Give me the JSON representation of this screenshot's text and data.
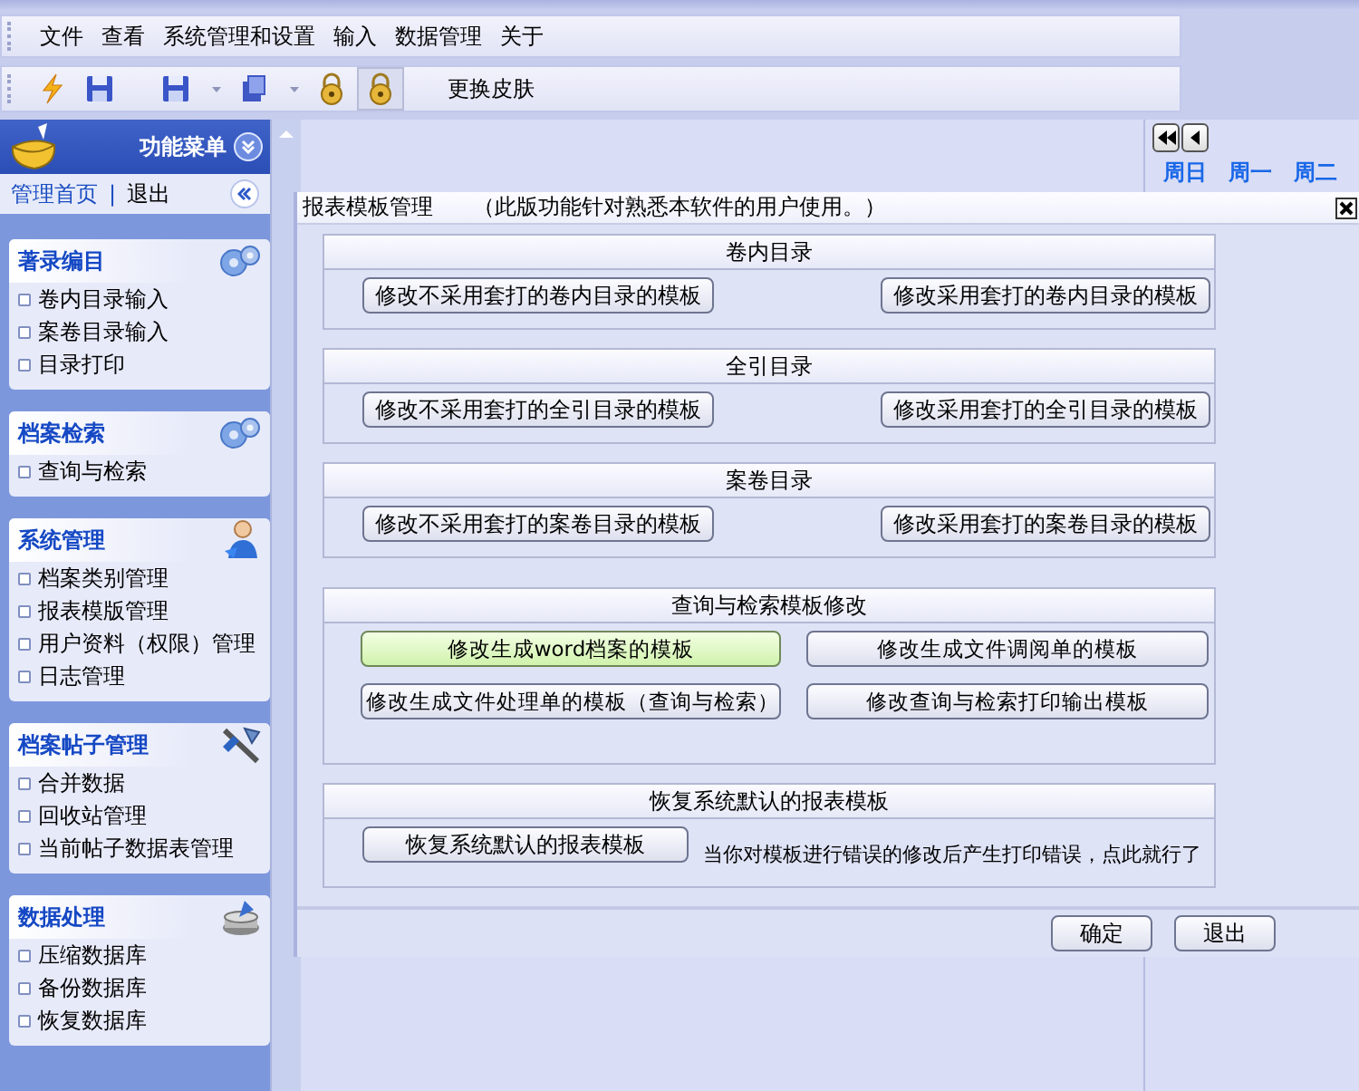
{
  "menu": [
    "文件",
    "查看",
    "系统管理和设置",
    "输入",
    "数据管理",
    "关于"
  ],
  "toolbar": {
    "skin_button": "更换皮肤"
  },
  "sidebar": {
    "title": "功能菜单",
    "home_link": "管理首页",
    "separator": "|",
    "exit_link": "退出",
    "sections": [
      {
        "title": "著录编目",
        "items": [
          "卷内目录输入",
          "案卷目录输入",
          "目录打印"
        ]
      },
      {
        "title": "档案检索",
        "items": [
          "查询与检索"
        ]
      },
      {
        "title": "系统管理",
        "items": [
          "档案类别管理",
          "报表模版管理",
          "用户资料（权限）管理",
          "日志管理"
        ]
      },
      {
        "title": "档案帖子管理",
        "items": [
          "合并数据",
          "回收站管理",
          "当前帖子数据表管理"
        ]
      },
      {
        "title": "数据处理",
        "items": [
          "压缩数据库",
          "备份数据库",
          "恢复数据库"
        ]
      }
    ]
  },
  "calendar": {
    "weekdays": [
      "周日",
      "周一",
      "周二"
    ]
  },
  "dialog": {
    "title": "报表模板管理",
    "note": "（此版功能针对熟悉本软件的用户使用。）",
    "groups": [
      {
        "title": "卷内目录",
        "kind": "pair",
        "buttons": [
          {
            "label": "修改不采用套打的卷内目录的模板",
            "highlighted": false
          },
          {
            "label": "修改采用套打的卷内目录的模板",
            "highlighted": false
          }
        ]
      },
      {
        "title": "全引目录",
        "kind": "pair",
        "buttons": [
          {
            "label": "修改不采用套打的全引目录的模板",
            "highlighted": false
          },
          {
            "label": "修改采用套打的全引目录的模板",
            "highlighted": false
          }
        ]
      },
      {
        "title": "案卷目录",
        "kind": "pair",
        "buttons": [
          {
            "label": "修改不采用套打的案卷目录的模板",
            "highlighted": false
          },
          {
            "label": "修改采用套打的案卷目录的模板",
            "highlighted": false
          }
        ]
      },
      {
        "title": "查询与检索模板修改",
        "kind": "grid",
        "buttons": [
          {
            "label": "修改生成word档案的模板",
            "highlighted": true
          },
          {
            "label": "修改生成文件调阅单的模板",
            "highlighted": false
          },
          {
            "label": "修改生成文件处理单的模板（查询与检索）",
            "highlighted": false
          },
          {
            "label": "修改查询与检索打印输出模板",
            "highlighted": false
          }
        ]
      },
      {
        "title": "恢复系统默认的报表模板",
        "kind": "action",
        "buttons": [
          {
            "label": "恢复系统默认的报表模板",
            "highlighted": false
          }
        ],
        "hint": "当你对模板进行错误的修改后产生打印错误，点此就行了"
      }
    ],
    "footer_buttons": [
      "确定",
      "退出"
    ]
  }
}
